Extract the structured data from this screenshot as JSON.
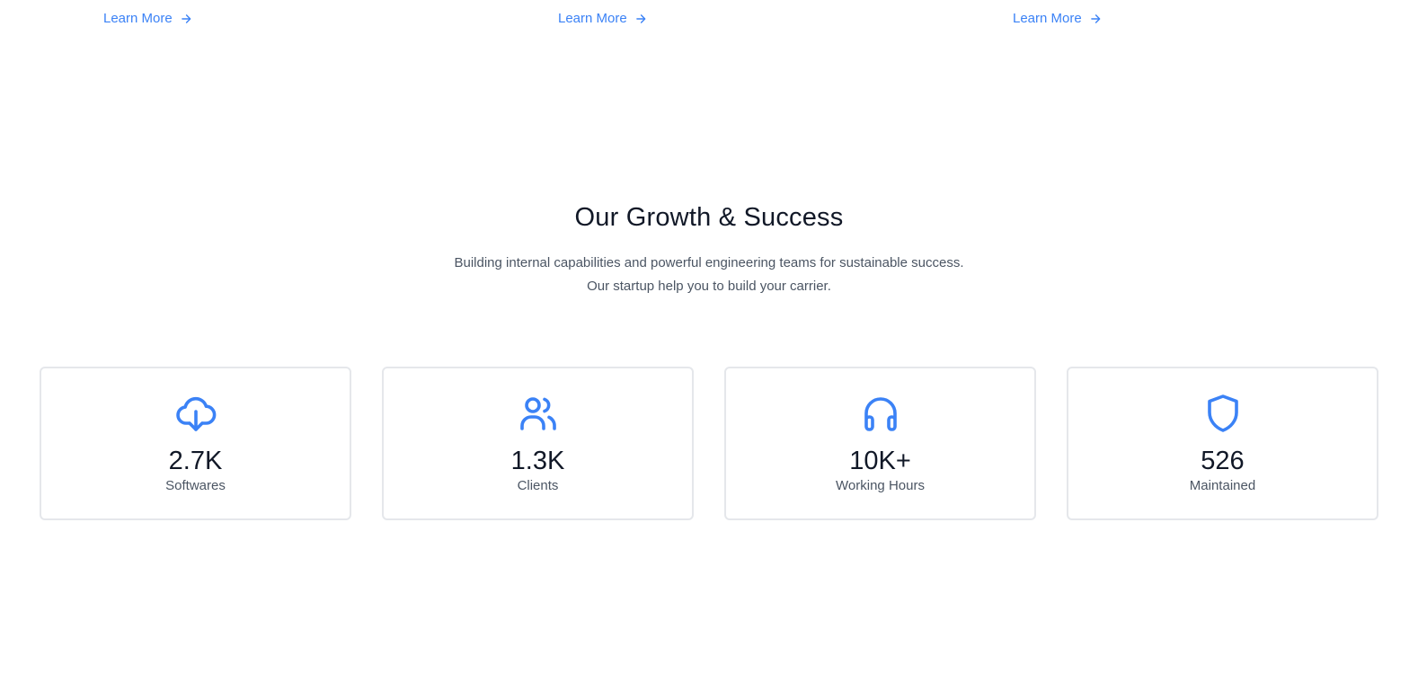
{
  "links": [
    {
      "label": "Learn More"
    },
    {
      "label": "Learn More"
    },
    {
      "label": "Learn More"
    }
  ],
  "growth": {
    "title": "Our Growth & Success",
    "description_line1": "Building internal capabilities and powerful engineering teams for sustainable success.",
    "description_line2": "Our startup help you to build your carrier."
  },
  "stats": [
    {
      "icon": "cloud-download-icon",
      "value": "2.7K",
      "label": "Softwares"
    },
    {
      "icon": "users-icon",
      "value": "1.3K",
      "label": "Clients"
    },
    {
      "icon": "headphones-icon",
      "value": "10K+",
      "label": "Working Hours"
    },
    {
      "icon": "shield-icon",
      "value": "526",
      "label": "Maintained"
    }
  ],
  "colors": {
    "accent": "#3b82f6",
    "heading": "#111827",
    "muted": "#4b5563",
    "border": "#e5e7eb"
  }
}
